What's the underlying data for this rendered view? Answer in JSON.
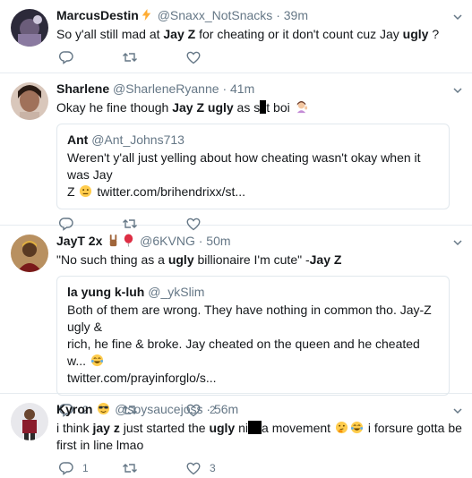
{
  "tweets": [
    {
      "name": "MarcusDestin",
      "handle": "@Snaxx_NotSnacks",
      "sep": "·",
      "time": "39m",
      "text": [
        "So y'all still mad at ",
        "Jay Z",
        " for cheating or it don't count cuz  Jay ",
        "ugly",
        " ?"
      ],
      "replies": "",
      "retweets": "",
      "likes": ""
    },
    {
      "name": "Sharlene",
      "handle": "@SharleneRyanne",
      "sep": "·",
      "time": "41m",
      "text": [
        "Okay he fine though ",
        "Jay Z ugly",
        " as s",
        "t boi"
      ],
      "quote": {
        "name": "Ant",
        "handle": "@Ant_Johns713",
        "text": [
          "Weren't y'all just yelling about how cheating wasn't okay when it was Jay",
          "Z",
          "twitter.com/brihendrixx/st..."
        ]
      },
      "replies": "",
      "retweets": "",
      "likes": ""
    },
    {
      "name": "JayT 2x",
      "handle": "@6KVNG",
      "sep": "·",
      "time": "50m",
      "text": [
        "\"No such thing as a ",
        "ugly",
        " billionaire I'm cute\" -",
        "Jay Z"
      ],
      "quote": {
        "name": "la yung k-luh",
        "handle": "@_ykSlim",
        "text": [
          "Both of them are wrong. They have nothing in common tho. Jay-Z ugly &",
          "rich, he fine & broke. Jay cheated on the queen and he cheated w...",
          "twitter.com/prayinforglo/s..."
        ]
      },
      "replies": "2",
      "retweets": "",
      "likes": "2"
    },
    {
      "name": "Kyron",
      "handle": "@soysaucejoss",
      "sep": "·",
      "time": "56m",
      "text": [
        "i think ",
        "jay z",
        " just started the ",
        "ugly",
        " ni",
        "a movement",
        "i forsure gotta be",
        "first in line lmao"
      ],
      "replies": "1",
      "retweets": "",
      "likes": "3"
    }
  ],
  "colors": {
    "text": "#14171a",
    "muted": "#657786",
    "border": "#e6ecf0",
    "quote_border": "#e1e8ed",
    "verified_bolt": "#ffac33"
  },
  "icons": {
    "reply": "reply-icon",
    "retweet": "retweet-icon",
    "like": "heart-icon",
    "more": "chevron-down-icon"
  }
}
